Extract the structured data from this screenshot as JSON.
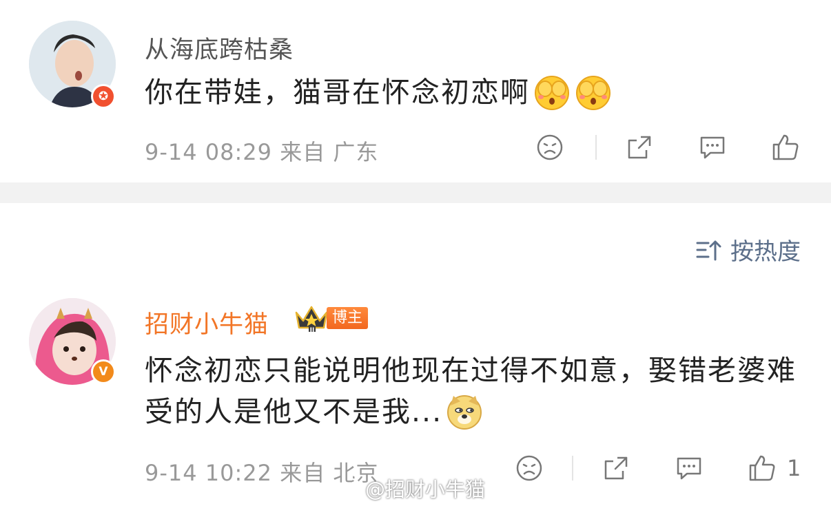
{
  "comments": [
    {
      "username": "从海底跨枯桑",
      "text": "你在带娃，猫哥在怀念初恋啊",
      "emojis": [
        "cover-eyes-emoji",
        "cover-eyes-emoji"
      ],
      "meta": "9-14 08:29  来自 广东",
      "badge": "✪",
      "like_count": ""
    },
    {
      "username": "招财小牛猫",
      "tag": "博主",
      "text": "怀念初恋只能说明他现在过得不如意，娶错老婆难受的人是他又不是我...",
      "emojis": [
        "doge-emoji"
      ],
      "meta": "9-14 10:22  来自 北京",
      "badge": "V",
      "like_count": "1"
    }
  ],
  "sort": {
    "label": "按热度"
  },
  "watermark": "@招财小牛猫",
  "colors": {
    "accent_orange": "#f27526",
    "meta_gray": "#999999",
    "sort_blue": "#5c6f8a",
    "separator": "#f2f2f2"
  }
}
